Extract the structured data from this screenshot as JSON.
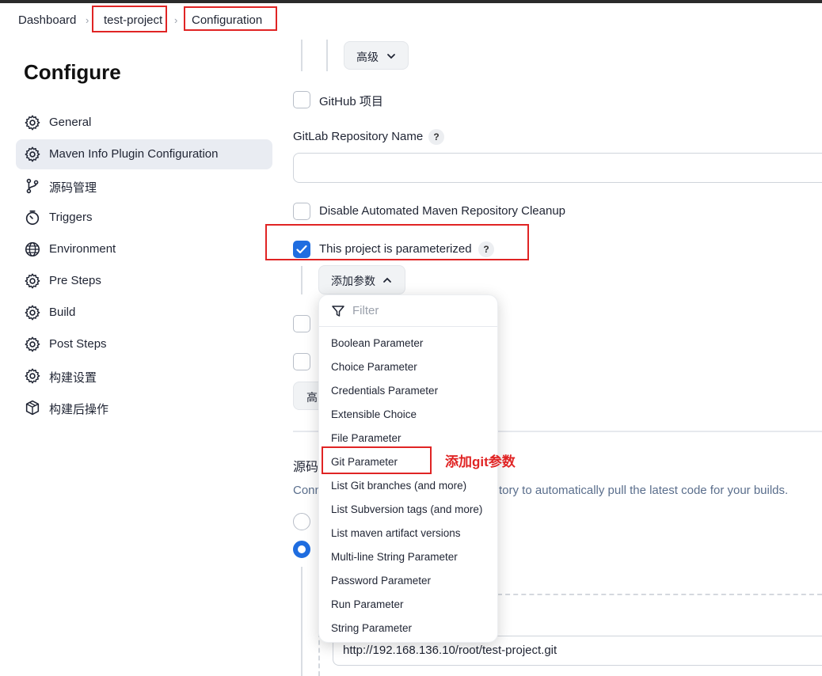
{
  "breadcrumb": {
    "items": [
      "Dashboard",
      "test-project",
      "Configuration"
    ]
  },
  "sidebar": {
    "title": "Configure",
    "items": [
      {
        "label": "General",
        "icon": "gear-icon"
      },
      {
        "label": "Maven Info Plugin Configuration",
        "icon": "gear-icon",
        "active": true
      },
      {
        "label": "源码管理",
        "icon": "git-branch-icon"
      },
      {
        "label": "Triggers",
        "icon": "timer-icon"
      },
      {
        "label": "Environment",
        "icon": "globe-icon"
      },
      {
        "label": "Pre Steps",
        "icon": "gear-icon"
      },
      {
        "label": "Build",
        "icon": "gear-icon"
      },
      {
        "label": "Post Steps",
        "icon": "gear-icon"
      },
      {
        "label": "构建设置",
        "icon": "gear-icon"
      },
      {
        "label": "构建后操作",
        "icon": "package-icon"
      }
    ]
  },
  "main": {
    "advanced_label": "高级",
    "github_project_label": "GitHub 项目",
    "gitlab_repo_name_label": "GitLab Repository Name",
    "gitlab_repo_name_value": "",
    "disable_cleanup_label": "Disable Automated Maven Repository Cleanup",
    "parameterized_label": "This project is parameterized",
    "add_param_label": "添加参数",
    "advanced_partial_label": "高",
    "source_section_title_partial": "源码",
    "source_desc_left": "Conn",
    "source_desc_right": "tory to automatically pull the latest code for your builds.",
    "repo_url_value": "http://192.168.136.10/root/test-project.git",
    "help_glyph": "?"
  },
  "dropdown": {
    "filter_placeholder": "Filter",
    "items": [
      "Boolean Parameter",
      "Choice Parameter",
      "Credentials Parameter",
      "Extensible Choice",
      "File Parameter",
      "Git Parameter",
      "List Git branches (and more)",
      "List Subversion tags (and more)",
      "List maven artifact versions",
      "Multi-line String Parameter",
      "Password Parameter",
      "Run Parameter",
      "String Parameter"
    ]
  },
  "annotation": {
    "text": "添加git参数",
    "color": "#e02424"
  },
  "colors": {
    "accent": "#1f6de0",
    "annotation_red": "#e02424"
  }
}
